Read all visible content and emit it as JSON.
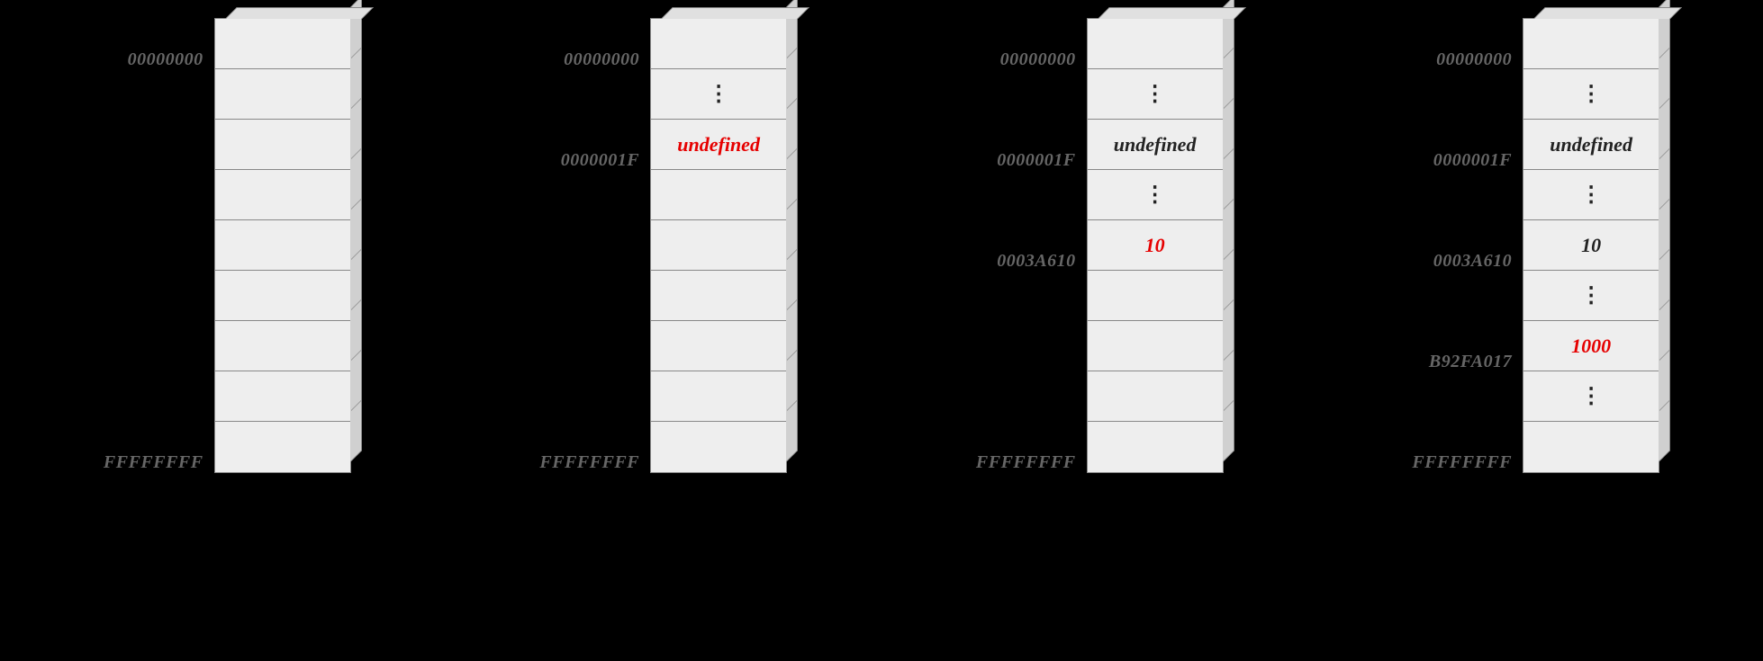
{
  "blocks": [
    {
      "id": "block-1",
      "rows": [
        {
          "addr": "00000000",
          "value": "",
          "highlight": false
        },
        {
          "addr": "",
          "value": "",
          "highlight": false
        },
        {
          "addr": "",
          "value": "",
          "highlight": false
        },
        {
          "addr": "",
          "value": "",
          "highlight": false
        },
        {
          "addr": "",
          "value": "",
          "highlight": false
        },
        {
          "addr": "",
          "value": "",
          "highlight": false
        },
        {
          "addr": "",
          "value": "",
          "highlight": false
        },
        {
          "addr": "",
          "value": "",
          "highlight": false
        },
        {
          "addr": "FFFFFFFF",
          "value": "",
          "highlight": false
        }
      ]
    },
    {
      "id": "block-2",
      "rows": [
        {
          "addr": "00000000",
          "value": "",
          "highlight": false
        },
        {
          "addr": "",
          "value": "⋮",
          "highlight": false,
          "dots": true
        },
        {
          "addr": "0000001F",
          "value": "undefined",
          "highlight": true
        },
        {
          "addr": "",
          "value": "",
          "highlight": false
        },
        {
          "addr": "",
          "value": "",
          "highlight": false
        },
        {
          "addr": "",
          "value": "",
          "highlight": false
        },
        {
          "addr": "",
          "value": "",
          "highlight": false
        },
        {
          "addr": "",
          "value": "",
          "highlight": false
        },
        {
          "addr": "FFFFFFFF",
          "value": "",
          "highlight": false
        }
      ]
    },
    {
      "id": "block-3",
      "rows": [
        {
          "addr": "00000000",
          "value": "",
          "highlight": false
        },
        {
          "addr": "",
          "value": "⋮",
          "highlight": false,
          "dots": true
        },
        {
          "addr": "0000001F",
          "value": "undefined",
          "highlight": false
        },
        {
          "addr": "",
          "value": "⋮",
          "highlight": false,
          "dots": true
        },
        {
          "addr": "0003A610",
          "value": "10",
          "highlight": true
        },
        {
          "addr": "",
          "value": "",
          "highlight": false
        },
        {
          "addr": "",
          "value": "",
          "highlight": false
        },
        {
          "addr": "",
          "value": "",
          "highlight": false
        },
        {
          "addr": "FFFFFFFF",
          "value": "",
          "highlight": false
        }
      ]
    },
    {
      "id": "block-4",
      "rows": [
        {
          "addr": "00000000",
          "value": "",
          "highlight": false
        },
        {
          "addr": "",
          "value": "⋮",
          "highlight": false,
          "dots": true
        },
        {
          "addr": "0000001F",
          "value": "undefined",
          "highlight": false
        },
        {
          "addr": "",
          "value": "⋮",
          "highlight": false,
          "dots": true
        },
        {
          "addr": "0003A610",
          "value": "10",
          "highlight": false
        },
        {
          "addr": "",
          "value": "⋮",
          "highlight": false,
          "dots": true
        },
        {
          "addr": "B92FA017",
          "value": "1000",
          "highlight": true
        },
        {
          "addr": "",
          "value": "⋮",
          "highlight": false,
          "dots": true
        },
        {
          "addr": "FFFFFFFF",
          "value": "",
          "highlight": false
        }
      ]
    }
  ]
}
